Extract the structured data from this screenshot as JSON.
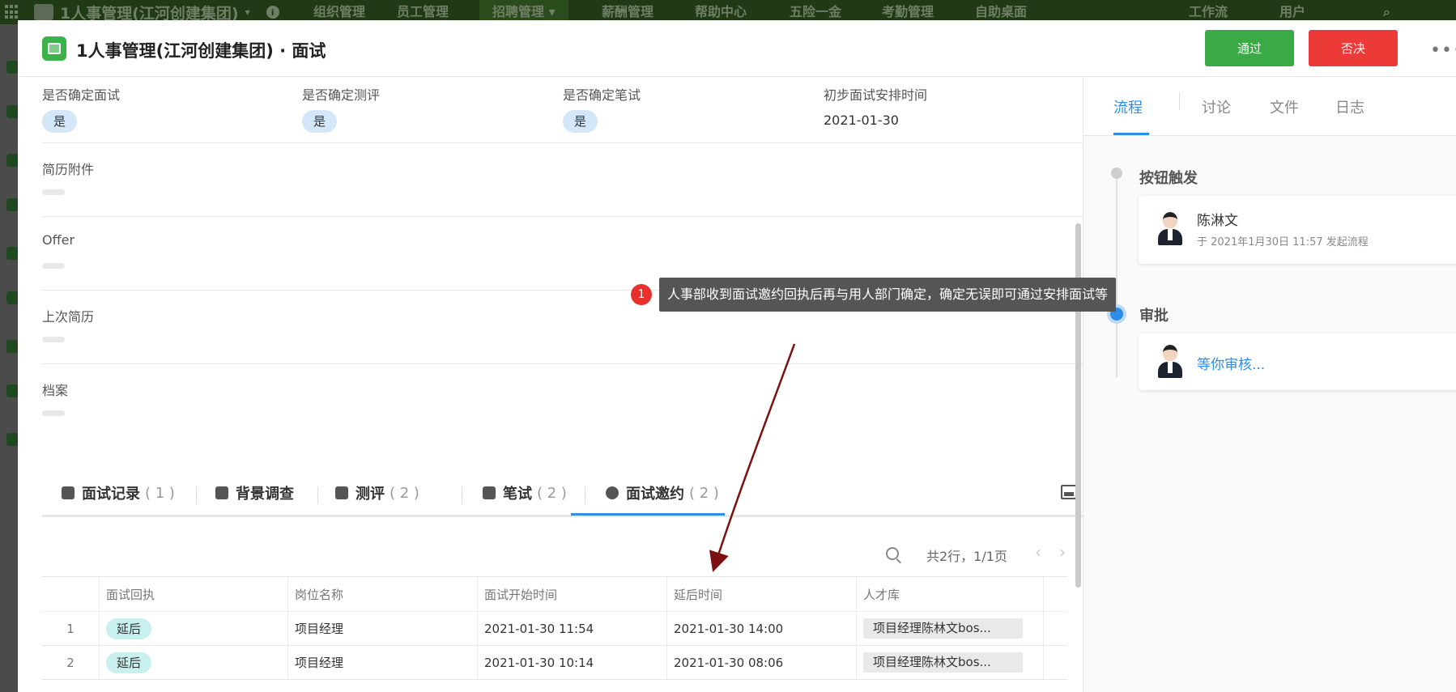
{
  "bg_nav": {
    "app_title": "1人事管理(江河创建集团)",
    "items": [
      "组织管理",
      "员工管理",
      "招聘管理",
      "薪酬管理",
      "帮助中心",
      "五险一金",
      "考勤管理",
      "自助桌面"
    ],
    "right_items": [
      "工作流",
      "用户"
    ]
  },
  "header": {
    "title": "1人事管理(江河创建集团) · 面试",
    "pass_label": "通过",
    "reject_label": "否决"
  },
  "form": {
    "fields": [
      {
        "label": "是否确定面试",
        "value": "是"
      },
      {
        "label": "是否确定测评",
        "value": "是"
      },
      {
        "label": "是否确定笔试",
        "value": "是"
      },
      {
        "label": "初步面试安排时间",
        "value": "2021-01-30"
      }
    ],
    "sections": [
      "简历附件",
      "Offer",
      "上次简历",
      "档案"
    ]
  },
  "tabs": [
    {
      "label": "面试记录",
      "count": "( 1 )"
    },
    {
      "label": "背景调查",
      "count": ""
    },
    {
      "label": "测评",
      "count": "( 2 )"
    },
    {
      "label": "笔试",
      "count": "( 2 )"
    },
    {
      "label": "面试邀约",
      "count": "( 2 )"
    }
  ],
  "pager": {
    "text": "共2行，1/1页",
    "prev": "‹",
    "next": "›"
  },
  "table": {
    "columns": [
      "面试回执",
      "岗位名称",
      "面试开始时间",
      "延后时间",
      "人才库"
    ],
    "rows": [
      {
        "no": "1",
        "receipt": "延后",
        "position": "项目经理",
        "start": "2021-01-30 11:54",
        "delay": "2021-01-30 14:00",
        "talent": "项目经理陈林文bos..."
      },
      {
        "no": "2",
        "receipt": "延后",
        "position": "项目经理",
        "start": "2021-01-30 10:14",
        "delay": "2021-01-30 08:06",
        "talent": "项目经理陈林文bos..."
      }
    ]
  },
  "side": {
    "tabs": [
      "流程",
      "讨论",
      "文件",
      "日志"
    ],
    "step1_title": "按钮触发",
    "step1_name": "陈淋文",
    "step1_sub": "于 2021年1月30日 11:57 发起流程",
    "step2_title": "审批",
    "step2_link": "等你审核..."
  },
  "tooltip": {
    "badge": "1",
    "text": "人事部收到面试邀约回执后再与用人部门确定，确定无误即可通过安排面试等"
  },
  "colors": {
    "primary": "#2d8de8",
    "pass": "#3aaa46",
    "reject": "#ec3a37",
    "nav_bg": "#1f3a14"
  }
}
